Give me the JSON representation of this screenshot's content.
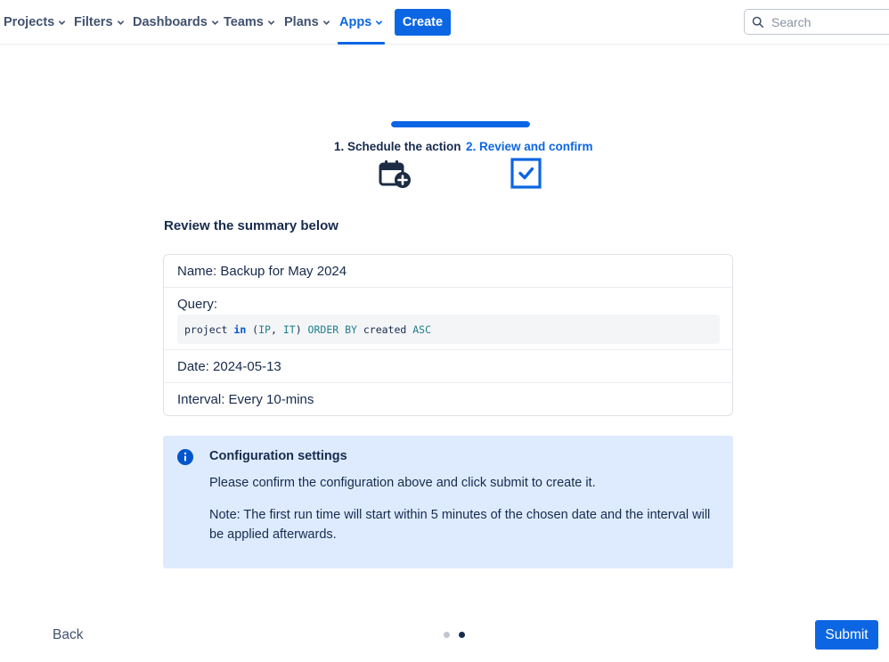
{
  "nav": {
    "items": [
      {
        "label": "Projects"
      },
      {
        "label": "Filters"
      },
      {
        "label": "Dashboards"
      },
      {
        "label": "Teams"
      },
      {
        "label": "Plans"
      },
      {
        "label": "Apps",
        "active": true
      }
    ],
    "create_label": "Create",
    "search_placeholder": "Search"
  },
  "wizard": {
    "progress_fraction": 1.0,
    "steps": [
      {
        "label": "1. Schedule the action",
        "icon": "calendar-plus-icon",
        "state": "completed"
      },
      {
        "label": "2. Review and confirm",
        "icon": "checkbox-checked-icon",
        "state": "current"
      }
    ]
  },
  "review": {
    "heading": "Review the summary below",
    "name": "Name: Backup for May 2024",
    "query_label": "Query:",
    "query_tokens": [
      {
        "text": "project ",
        "kind": "plain"
      },
      {
        "text": "in",
        "kind": "kw"
      },
      {
        "text": " (",
        "kind": "plain"
      },
      {
        "text": "IP",
        "kind": "id"
      },
      {
        "text": ", ",
        "kind": "plain"
      },
      {
        "text": "IT",
        "kind": "id"
      },
      {
        "text": ") ",
        "kind": "plain"
      },
      {
        "text": "ORDER BY",
        "kind": "id"
      },
      {
        "text": " created ",
        "kind": "plain"
      },
      {
        "text": "ASC",
        "kind": "id"
      }
    ],
    "date": "Date: 2024-05-13",
    "interval": "Interval: Every 10-mins"
  },
  "info": {
    "title": "Configuration settings",
    "body": "Please confirm the configuration above and click submit to create it.",
    "note": "Note: The first run time will start within 5 minutes of the chosen date and the interval will be applied afterwards."
  },
  "footer": {
    "back_label": "Back",
    "submit_label": "Submit",
    "pages": 2,
    "current_page": 2
  },
  "colors": {
    "primary": "#0c66e4",
    "info_bg": "#deebff",
    "text": "#172b4d"
  }
}
